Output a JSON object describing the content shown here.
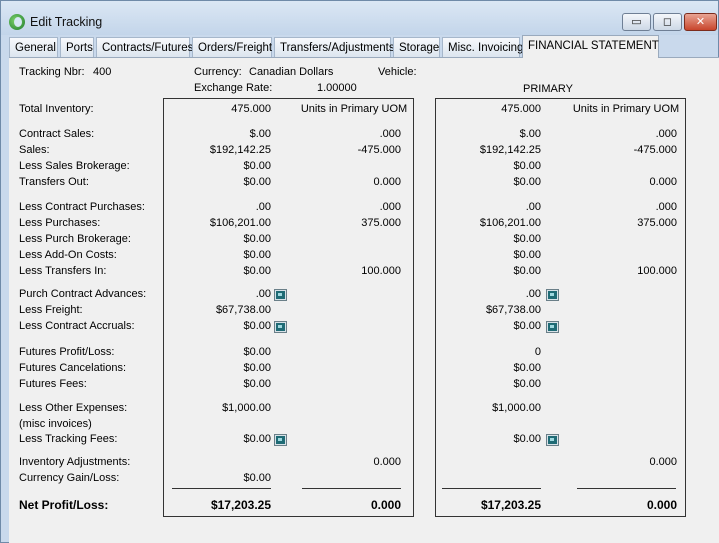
{
  "window": {
    "title": "Edit Tracking",
    "min_glyph": "▭",
    "max_glyph": "◻",
    "close_glyph": "✕"
  },
  "tabs": [
    {
      "label": "General"
    },
    {
      "label": "Ports"
    },
    {
      "label": "Contracts/Futures"
    },
    {
      "label": "Orders/Freight"
    },
    {
      "label": "Transfers/Adjustments"
    },
    {
      "label": "Storage"
    },
    {
      "label": "Misc. Invoicing"
    },
    {
      "label": "FINANCIAL STATEMENT"
    }
  ],
  "header": {
    "tracking_label": "Tracking Nbr:",
    "tracking_value": "400",
    "currency_label": "Currency:",
    "currency_value": "Canadian Dollars",
    "vehicle_label": "Vehicle:",
    "vehicle_value": "",
    "exchange_label": "Exchange Rate:",
    "exchange_value": "1.00000",
    "primary_label": "PRIMARY"
  },
  "labels": [
    "Total Inventory:",
    "Contract Sales:",
    "Sales:",
    "Less Sales Brokerage:",
    "Transfers Out:",
    "Less Contract Purchases:",
    "Less Purchases:",
    "Less Purch Brokerage:",
    "Less Add-On Costs:",
    "Less Transfers In:",
    "Purch Contract Advances:",
    "Less  Freight:",
    "Less Contract Accruals:",
    "Futures Profit/Loss:",
    "Futures Cancelations:",
    "Futures Fees:",
    "Less Other Expenses:",
    "(misc invoices)",
    "Less Tracking Fees:",
    "Inventory Adjustments:",
    "Currency Gain/Loss:"
  ],
  "net": {
    "label": "Net Profit/Loss:",
    "local_amount": "$17,203.25",
    "local_qty": "0.000",
    "primary_amount": "$17,203.25",
    "primary_qty": "0.000"
  },
  "local": {
    "amounts": [
      "475.000",
      "$.00",
      "$192,142.25",
      "$0.00",
      "$0.00",
      ".00",
      "$106,201.00",
      "$0.00",
      "$0.00",
      "$0.00",
      ".00",
      "$67,738.00",
      "$0.00",
      "$0.00",
      "$0.00",
      "$0.00",
      "$1,000.00",
      "",
      "$0.00",
      "",
      "$0.00"
    ],
    "qtys": [
      "Units in Primary UOM",
      ".000",
      "-475.000",
      "",
      "0.000",
      ".000",
      "375.000",
      "",
      "",
      "100.000",
      "",
      "",
      "",
      "",
      "",
      "",
      "",
      "",
      "",
      "0.000",
      ""
    ]
  },
  "primary": {
    "amounts": [
      "475.000",
      "$.00",
      "$192,142.25",
      "$0.00",
      "$0.00",
      ".00",
      "$106,201.00",
      "$0.00",
      "$0.00",
      "$0.00",
      ".00",
      "$67,738.00",
      "$0.00",
      "0",
      "$0.00",
      "$0.00",
      "$1,000.00",
      "",
      "$0.00",
      "",
      ""
    ],
    "qtys": [
      "Units in Primary UOM",
      ".000",
      "-475.000",
      "",
      "0.000",
      ".000",
      "375.000",
      "",
      "",
      "100.000",
      "",
      "",
      "",
      "",
      "",
      "",
      "",
      "",
      "",
      "0.000",
      ""
    ]
  }
}
